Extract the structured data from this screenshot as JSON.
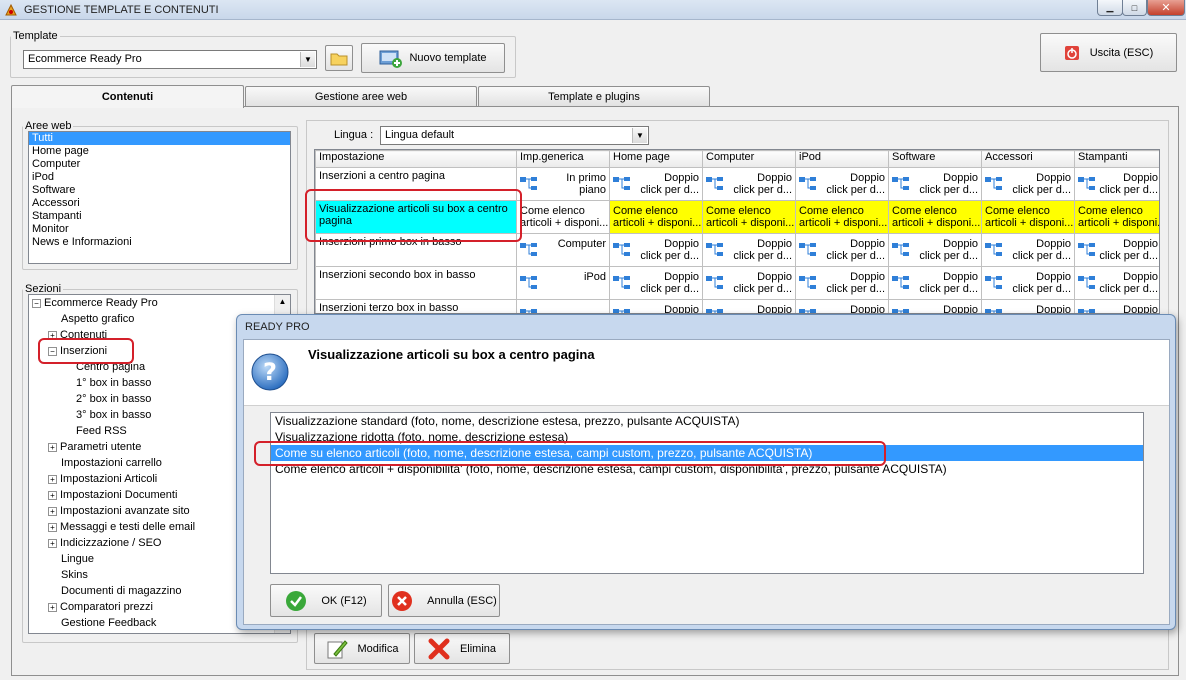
{
  "window": {
    "title": "GESTIONE TEMPLATE E CONTENUTI"
  },
  "template": {
    "legend": "Template",
    "selected": "Ecommerce Ready Pro",
    "new_label": "Nuovo template"
  },
  "exit_label": "Uscita (ESC)",
  "tabs": [
    {
      "label": "Contenuti"
    },
    {
      "label": "Gestione aree web"
    },
    {
      "label": "Template e plugins"
    }
  ],
  "aree": {
    "legend": "Aree web",
    "items": [
      "Tutti",
      "Home page",
      "Computer",
      "iPod",
      "Software",
      "Accessori",
      "Stampanti",
      "Monitor",
      "News e Informazioni"
    ]
  },
  "sezioni": {
    "legend": "Sezioni",
    "root": "Ecommerce Ready Pro",
    "items": [
      "Aspetto grafico",
      "Contenuti",
      "Inserzioni",
      "Centro pagina",
      "1° box in basso",
      "2° box in basso",
      "3° box in basso",
      "Feed RSS",
      "Parametri utente",
      "Impostazioni carrello",
      "Impostazioni Articoli",
      "Impostazioni Documenti",
      "Impostazioni avanzate sito",
      "Messaggi e testi delle email",
      "Indicizzazione / SEO",
      "Lingue",
      "Skins",
      "Documenti di magazzino",
      "Comparatori prezzi",
      "Gestione Feedback"
    ]
  },
  "lingua": {
    "label": "Lingua :",
    "selected": "Lingua default"
  },
  "grid": {
    "headers": [
      "Impostazione",
      "Imp.generica",
      "Home page",
      "Computer",
      "iPod",
      "Software",
      "Accessori",
      "Stampanti"
    ],
    "rows": [
      {
        "caption": "Inserzioni a centro pagina",
        "generic": [
          "In primo",
          "piano"
        ],
        "other": [
          "Doppio",
          "click per d..."
        ]
      },
      {
        "caption": "Visualizzazione articoli su box a centro pagina",
        "generic": [
          "Come elenco",
          "articoli + disponi..."
        ],
        "other": [
          "Come elenco",
          "articoli + disponi..."
        ]
      },
      {
        "caption": "Inserzioni primo box in basso",
        "generic": [
          "",
          "Computer"
        ],
        "other": [
          "Doppio",
          "click per d..."
        ]
      },
      {
        "caption": "Inserzioni secondo box in basso",
        "generic": [
          "iPod",
          ""
        ],
        "other": [
          "Doppio",
          "click per d..."
        ]
      },
      {
        "caption": "Inserzioni terzo box in basso",
        "generic": [
          "",
          ""
        ],
        "other": [
          "Doppio",
          ""
        ]
      }
    ]
  },
  "buttons": {
    "modifica": "Modifica",
    "elimina": "Elimina"
  },
  "dialog": {
    "title": "READY PRO",
    "heading": "Visualizzazione articoli su box a centro pagina",
    "options": [
      "Visualizzazione standard (foto, nome, descrizione estesa, prezzo, pulsante ACQUISTA)",
      "Visualizzazione ridotta (foto, nome, descrizione estesa)",
      "Come su elenco articoli (foto, nome, descrizione estesa, campi custom, prezzo, pulsante ACQUISTA)",
      "Come elenco articoli + disponibilita' (foto, nome, descrizione estesa, campi custom, disponibilita', prezzo, pulsante ACQUISTA)"
    ],
    "selected_index": 2,
    "ok_label": "OK (F12)",
    "cancel_label": "Annulla (ESC)"
  },
  "colors": {
    "selection": "#3399ff",
    "highlight_yellow": "#ffff00",
    "highlight_cyan": "#00ffff",
    "annotation_red": "#d4202a"
  }
}
